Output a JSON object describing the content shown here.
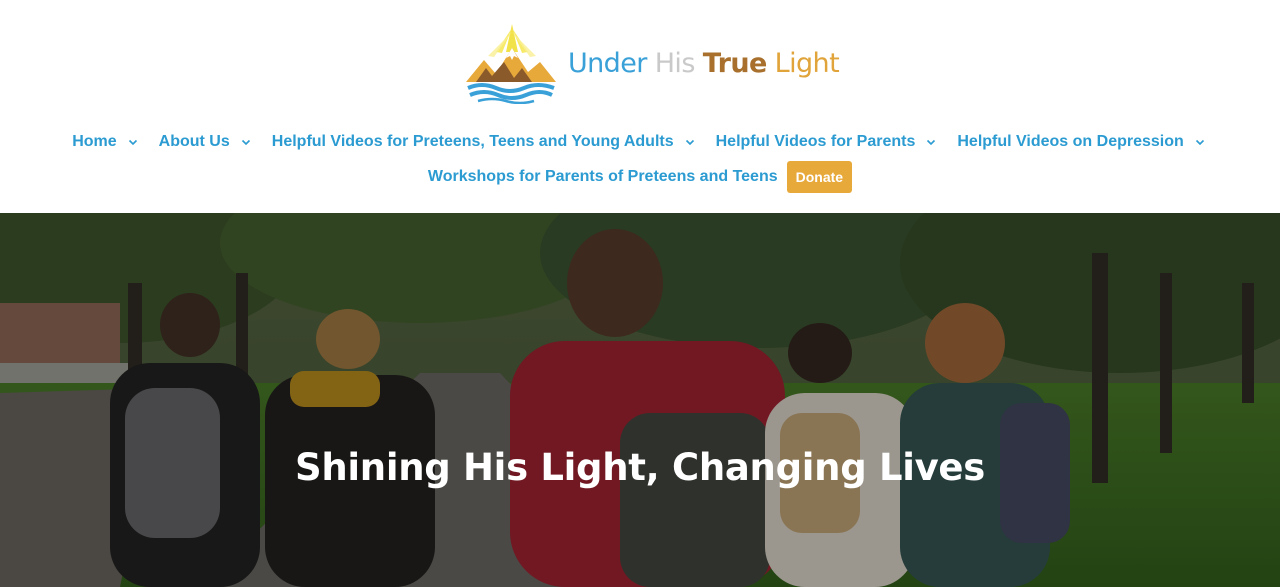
{
  "site": {
    "logo_words": [
      "Under",
      "His",
      "True",
      "Light"
    ],
    "colors": {
      "nav": "#2b9bd1",
      "donate_bg": "#e8a93b",
      "logo_blue": "#3aa0d8",
      "logo_brown": "#a8702c",
      "logo_gold": "#e0a43a"
    }
  },
  "nav": {
    "row1": [
      {
        "label": "Home",
        "has_submenu": true
      },
      {
        "label": "About Us",
        "has_submenu": true
      },
      {
        "label": "Helpful Videos for Preteens, Teens and Young Adults",
        "has_submenu": true
      },
      {
        "label": "Helpful Videos for Parents",
        "has_submenu": true
      },
      {
        "label": "Helpful Videos on Depression",
        "has_submenu": true
      }
    ],
    "row2": [
      {
        "label": "Workshops for Parents of Preteens and Teens",
        "has_submenu": false
      }
    ],
    "donate_label": "Donate",
    "chevron_icon": "chevron-down-icon"
  },
  "hero": {
    "title": "Shining His Light, Changing Lives"
  }
}
